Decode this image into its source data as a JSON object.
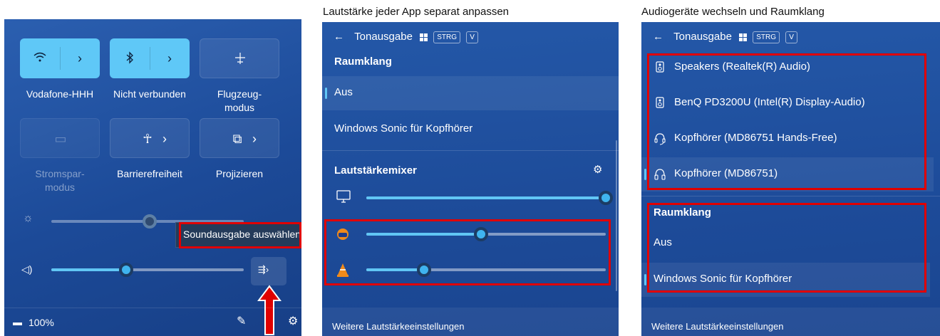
{
  "captions": {
    "middle": "Lautstärke jeder App separat anpassen",
    "right": "Audiogeräte wechseln und Raumklang"
  },
  "quick_settings": {
    "tiles": [
      {
        "label": "Vodafone-HHH",
        "icon": "wifi-icon",
        "state": "on"
      },
      {
        "label": "Nicht verbunden",
        "icon": "bluetooth-icon",
        "state": "on"
      },
      {
        "label": "Flugzeug-\nmodus",
        "label_line1": "Flugzeug-",
        "label_line2": "modus",
        "icon": "airplane-icon",
        "state": "off"
      },
      {
        "label_line1": "Stromspar-",
        "label_line2": "modus",
        "icon": "battery-saver-icon",
        "state": "disabled"
      },
      {
        "label": "Barrierefreiheit",
        "icon": "accessibility-icon",
        "state": "off"
      },
      {
        "label": "Projizieren",
        "icon": "project-icon",
        "state": "off"
      }
    ],
    "brightness_level": 0.51,
    "volume_level": 0.39,
    "tooltip": "Soundausgabe auswählen",
    "battery": "100%",
    "colors": {
      "accent": "#5fc8f7",
      "highlight": "#e00000"
    }
  },
  "mixer_panel": {
    "back_icon": "←",
    "title": "Tonausgabe",
    "kbd1": "STRG",
    "kbd2": "V",
    "section_spatial": "Raumklang",
    "spatial_options": [
      "Aus",
      "Windows Sonic für Kopfhörer"
    ],
    "mixer_title": "Lautstärkemixer",
    "apps": [
      {
        "icon": "monitor-icon",
        "level": 1.0
      },
      {
        "icon": "headphones-app-icon",
        "level": 0.48
      },
      {
        "icon": "vlc-icon",
        "level": 0.24
      }
    ],
    "footer": "Weitere Lautstärkeeinstellungen"
  },
  "device_panel": {
    "back_icon": "←",
    "title": "Tonausgabe",
    "kbd1": "STRG",
    "kbd2": "V",
    "devices": [
      {
        "label": "Speakers (Realtek(R) Audio)",
        "icon": "speaker-icon"
      },
      {
        "label": "BenQ PD3200U (Intel(R) Display-Audio)",
        "icon": "speaker-icon"
      },
      {
        "label": "Kopfhörer (MD86751 Hands-Free)",
        "icon": "headset-icon"
      },
      {
        "label": "Kopfhörer (MD86751)",
        "icon": "headphones-icon",
        "selected": true
      }
    ],
    "section_spatial": "Raumklang",
    "spatial_options": [
      "Aus",
      "Windows Sonic für Kopfhörer"
    ],
    "footer": "Weitere Lautstärkeeinstellungen"
  }
}
